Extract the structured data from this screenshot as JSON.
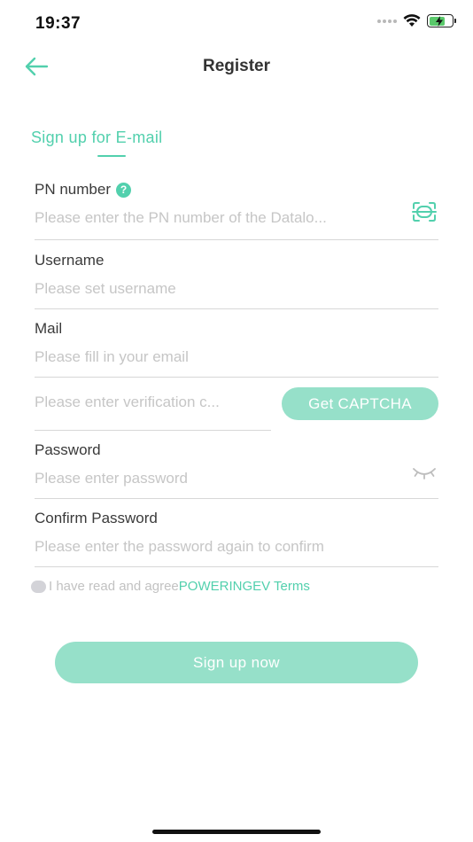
{
  "status_bar": {
    "time": "19:37"
  },
  "nav": {
    "title": "Register"
  },
  "section_tab": {
    "label": "Sign up for E-mail"
  },
  "fields": {
    "pn": {
      "label": "PN number",
      "help_glyph": "?",
      "placeholder": "Please enter the PN number of the Datalo..."
    },
    "username": {
      "label": "Username",
      "placeholder": "Please set username"
    },
    "mail": {
      "label": "Mail",
      "placeholder": "Please fill in your email"
    },
    "verification": {
      "placeholder": "Please enter verification c..."
    },
    "password": {
      "label": "Password",
      "placeholder": "Please enter password"
    },
    "confirm_password": {
      "label": "Confirm Password",
      "placeholder": "Please enter the password again to confirm"
    }
  },
  "captcha_button": {
    "label": "Get CAPTCHA"
  },
  "agreement": {
    "text": "I have read and agree",
    "link": "POWERINGEV Terms",
    "checked": false
  },
  "submit": {
    "label": "Sign up now"
  },
  "icons": {
    "back": "arrow-left-icon",
    "scan": "scan-icon",
    "password_visibility": "eye-closed-icon",
    "help": "help-icon"
  },
  "colors": {
    "accent": "#52d0ad",
    "button_bg": "#96e0c9",
    "placeholder": "#c6c6c6",
    "divider": "#d7d7d7"
  }
}
